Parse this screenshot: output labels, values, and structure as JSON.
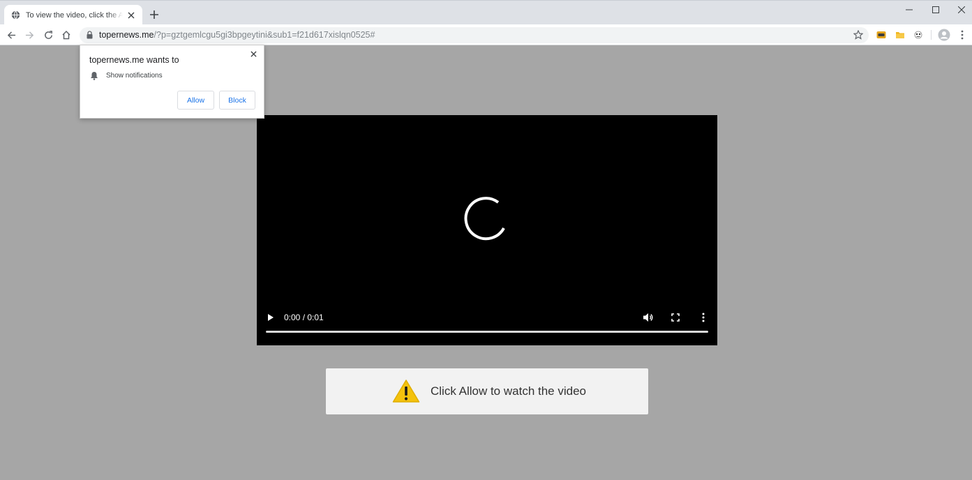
{
  "browser": {
    "tab": {
      "title": "To view the video, click the Allow button"
    },
    "address_bar": {
      "host": "topernews.me",
      "path": "/?p=gztgemlcgu5gi3bpgeytini&sub1=f21d617xislqn0525#"
    }
  },
  "permission_prompt": {
    "title": "topernews.me wants to",
    "permission": "Show notifications",
    "allow_label": "Allow",
    "block_label": "Block"
  },
  "video": {
    "time_display": "0:00 / 0:01",
    "state": "loading",
    "progress": 0.0
  },
  "banner": {
    "text": "Click Allow to watch the video",
    "icon": "warning-icon"
  },
  "colors": {
    "page_background": "#a6a6a6",
    "link_blue": "#1a73e8",
    "warning_yellow": "#f4c20d"
  }
}
